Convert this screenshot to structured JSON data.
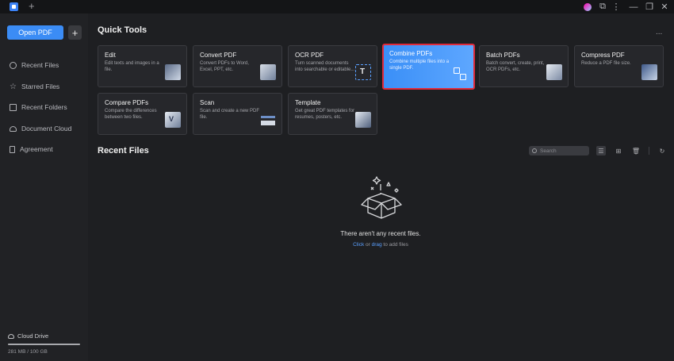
{
  "titlebar": {
    "new_tab": "+",
    "controls": [
      "⧉",
      "⋮",
      "—",
      "❐",
      "✕"
    ]
  },
  "sidebar": {
    "open_pdf": "Open PDF",
    "add": "+",
    "items": [
      {
        "label": "Recent Files",
        "icon": "clock-icon"
      },
      {
        "label": "Starred Files",
        "icon": "star-icon"
      },
      {
        "label": "Recent Folders",
        "icon": "folder-icon"
      },
      {
        "label": "Document Cloud",
        "icon": "cloud-icon"
      },
      {
        "label": "Agreement",
        "icon": "document-icon"
      }
    ],
    "cloud_drive": "Cloud Drive",
    "storage": "281 MB / 100 GB",
    "storage_used_fraction": 0.00275
  },
  "quick_tools": {
    "title": "Quick Tools",
    "more": "...",
    "cards": [
      {
        "title": "Edit",
        "desc": "Edit texts and images in a file.",
        "icon": "edit-icon"
      },
      {
        "title": "Convert PDF",
        "desc": "Convert PDFs to Word, Excel, PPT, etc.",
        "icon": "convert-icon"
      },
      {
        "title": "OCR PDF",
        "desc": "Turn scanned documents into searchable or editable...",
        "icon": "ocr-icon"
      },
      {
        "title": "Combine PDFs",
        "desc": "Combine multiple files into a single PDF.",
        "icon": "combine-icon"
      },
      {
        "title": "Batch PDFs",
        "desc": "Batch convert, create, print, OCR PDFs, etc.",
        "icon": "batch-icon"
      },
      {
        "title": "Compress PDF",
        "desc": "Reduce a PDF file size.",
        "icon": "compress-icon"
      },
      {
        "title": "Compare PDFs",
        "desc": "Compare the differences between two files.",
        "icon": "compare-icon"
      },
      {
        "title": "Scan",
        "desc": "Scan and create a new PDF file.",
        "icon": "scan-icon"
      },
      {
        "title": "Template",
        "desc": "Get great PDF templates for resumes, posters, etc.",
        "icon": "template-icon"
      }
    ]
  },
  "recent_files": {
    "title": "Recent Files",
    "search_placeholder": "Search",
    "empty_title": "There aren't any recent files.",
    "empty_hint_click": "Click",
    "empty_hint_or": " or ",
    "empty_hint_drag": "drag",
    "empty_hint_rest": " to add files"
  },
  "colors": {
    "accent": "#3b8cf5",
    "highlight_border": "#e02a3a",
    "background": "#1e1f22"
  }
}
